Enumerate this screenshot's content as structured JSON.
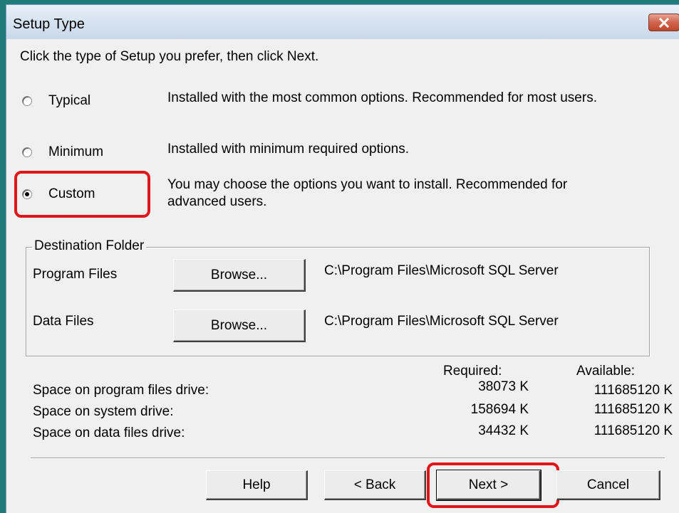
{
  "window": {
    "title": "Setup Type"
  },
  "instruction": "Click the type of Setup you prefer, then click Next.",
  "setup_options": [
    {
      "label": "Typical",
      "description": "Installed with the most common options. Recommended for most users.",
      "selected": false
    },
    {
      "label": "Minimum",
      "description": "Installed with minimum required options.",
      "selected": false
    },
    {
      "label": "Custom",
      "description_line1": "You may choose the options you want to install. Recommended for",
      "description_line2": "advanced users.",
      "selected": true
    }
  ],
  "destination": {
    "legend": "Destination Folder",
    "program_files_label": "Program Files",
    "program_files_browse": "Browse...",
    "program_files_path": "C:\\Program Files\\Microsoft SQL Server",
    "data_files_label": "Data Files",
    "data_files_browse": "Browse...",
    "data_files_path": "C:\\Program Files\\Microsoft SQL Server"
  },
  "space": {
    "required_header": "Required:",
    "available_header": "Available:",
    "rows": [
      {
        "label": "Space on program files drive:",
        "required": "38073 K",
        "available": "111685120 K"
      },
      {
        "label": "Space on system drive:",
        "required": "158694 K",
        "available": "111685120 K"
      },
      {
        "label": "Space on data files drive:",
        "required": "34432 K",
        "available": "111685120 K"
      }
    ]
  },
  "buttons": {
    "help": "Help",
    "back": "< Back",
    "next": "Next >",
    "cancel": "Cancel"
  },
  "colors": {
    "highlight": "#e0161b",
    "desktop": "#1f7a78",
    "dialog_bg": "#f0f0f0"
  }
}
